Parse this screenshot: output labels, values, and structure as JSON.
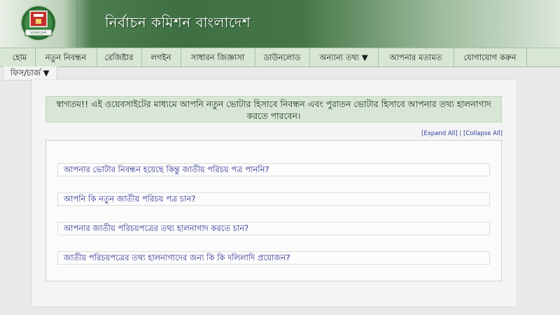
{
  "header": {
    "title": "নির্বাচন কমিশন বাংলাদেশ",
    "logo_text": "বাংলাদেশ"
  },
  "nav": {
    "items": [
      {
        "label": "হোম"
      },
      {
        "label": "নতুন নিবন্ধন"
      },
      {
        "label": "রেজিষ্টার"
      },
      {
        "label": "লগইন"
      },
      {
        "label": "সাধারন জিজ্ঞাসা"
      },
      {
        "label": "ডাউনলোড"
      },
      {
        "label": "অন্যান্য তথ্য ▼"
      },
      {
        "label": "আপনার মতামত"
      },
      {
        "label": "যোগাযোগ করুন"
      }
    ],
    "fees_label": "ফিস/চার্জ ▼"
  },
  "main": {
    "welcome_text": "স্বাগতম!! এই ওয়েবসাইটের মাধ্যমে আপনি নতুন ভোটার হিসাবে নিবন্ধন এবং পুরাতন ভোটার হিসাবে আপনার তথ্য হালনাগাদ করতে পারবেন।",
    "expand_all": "[Expand All]",
    "separator": " | ",
    "collapse_all": "[Collapse All]",
    "faqs": [
      {
        "question": "আপনার ভোটার নিবন্ধন হয়েছে কিন্তু জাতীয় পরিচয় পত্র পাননি?"
      },
      {
        "question": "আপনি কি নতুন জাতীয় পরিচয় পত্র চান?"
      },
      {
        "question": "আপনার জাতীয় পরিচয়পত্রের তথ্য হালনাগাদ করতে চান?"
      },
      {
        "question": "জাতীয় পরিচয়পত্রের তথ্য হালনাগাদের জন্য কি কি দলিলাদি প্রয়োজন?"
      }
    ]
  },
  "colors": {
    "header_green": "#3f7043",
    "nav_bg": "#d7e7d4",
    "link_blue": "#2a2f8f",
    "logo_red": "#c4302b"
  }
}
